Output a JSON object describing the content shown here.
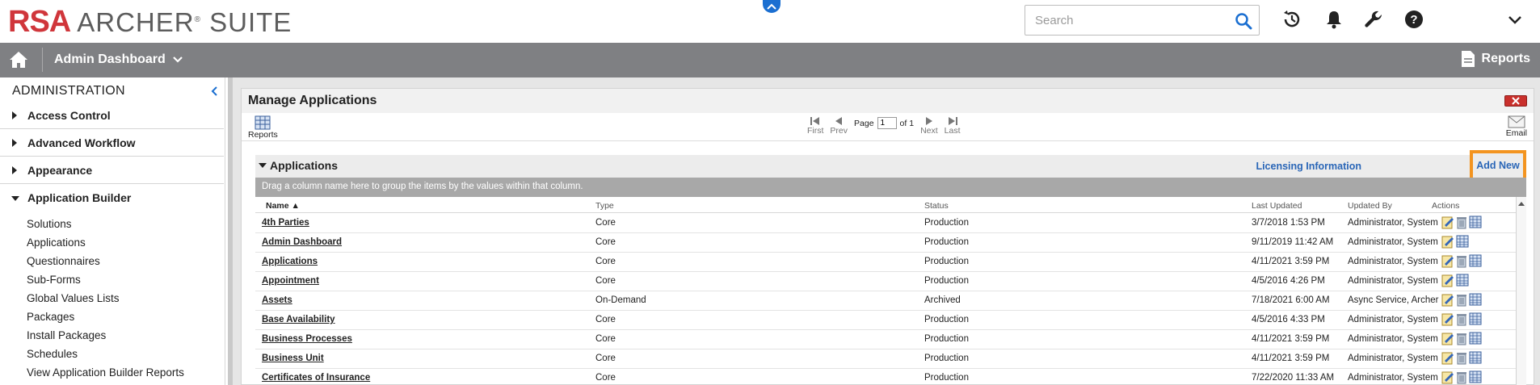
{
  "header": {
    "logo_brand": "RSA",
    "logo_product": "ARCHER",
    "logo_suite": "SUITE",
    "search_placeholder": "Search"
  },
  "navbar": {
    "title": "Admin Dashboard",
    "reports_label": "Reports"
  },
  "sidebar": {
    "title": "ADMINISTRATION",
    "sections": [
      {
        "label": "Access Control",
        "expanded": false
      },
      {
        "label": "Advanced Workflow",
        "expanded": false
      },
      {
        "label": "Appearance",
        "expanded": false
      },
      {
        "label": "Application Builder",
        "expanded": true
      }
    ],
    "items": [
      "Solutions",
      "Applications",
      "Questionnaires",
      "Sub-Forms",
      "Global Values Lists",
      "Packages",
      "Install Packages",
      "Schedules",
      "View Application Builder Reports"
    ]
  },
  "panel": {
    "title": "Manage Applications",
    "toolbar": {
      "reports_label": "Reports",
      "email_label": "Email",
      "first": "First",
      "prev": "Prev",
      "next": "Next",
      "last": "Last",
      "page_label": "Page",
      "page_value": "1",
      "of_label": "of 1"
    },
    "section_title": "Applications",
    "licensing_link": "Licensing Information",
    "add_new": "Add New",
    "group_hint": "Drag a column name here to group the items by the values within that column.",
    "columns": {
      "name": "Name ▲",
      "type": "Type",
      "status": "Status",
      "last_updated": "Last Updated",
      "updated_by": "Updated By",
      "actions": "Actions"
    },
    "rows": [
      {
        "name": "4th Parties",
        "type": "Core",
        "status": "Production",
        "last_updated": "3/7/2018 1:53 PM",
        "updated_by": "Administrator, System",
        "delete": true
      },
      {
        "name": "Admin Dashboard",
        "type": "Core",
        "status": "Production",
        "last_updated": "9/11/2019 11:42 AM",
        "updated_by": "Administrator, System",
        "delete": false
      },
      {
        "name": "Applications",
        "type": "Core",
        "status": "Production",
        "last_updated": "4/11/2021 3:59 PM",
        "updated_by": "Administrator, System",
        "delete": true
      },
      {
        "name": "Appointment",
        "type": "Core",
        "status": "Production",
        "last_updated": "4/5/2016 4:26 PM",
        "updated_by": "Administrator, System",
        "delete": false
      },
      {
        "name": "Assets",
        "type": "On-Demand",
        "status": "Archived",
        "last_updated": "7/18/2021 6:00 AM",
        "updated_by": "Async Service, Archer",
        "delete": true
      },
      {
        "name": "Base Availability",
        "type": "Core",
        "status": "Production",
        "last_updated": "4/5/2016 4:33 PM",
        "updated_by": "Administrator, System",
        "delete": true
      },
      {
        "name": "Business Processes",
        "type": "Core",
        "status": "Production",
        "last_updated": "4/11/2021 3:59 PM",
        "updated_by": "Administrator, System",
        "delete": true
      },
      {
        "name": "Business Unit",
        "type": "Core",
        "status": "Production",
        "last_updated": "4/11/2021 3:59 PM",
        "updated_by": "Administrator, System",
        "delete": true
      },
      {
        "name": "Certificates of Insurance",
        "type": "Core",
        "status": "Production",
        "last_updated": "7/22/2020 11:33 AM",
        "updated_by": "Administrator, System",
        "delete": true
      }
    ]
  }
}
